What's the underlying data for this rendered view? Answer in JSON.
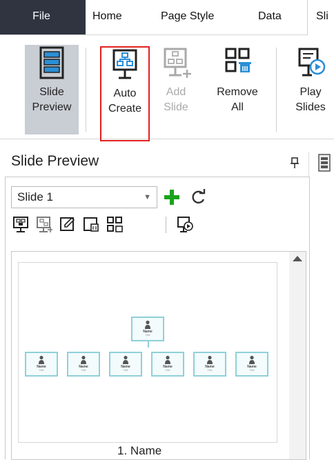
{
  "menu": {
    "items": [
      "File",
      "Home",
      "Page Style",
      "Data"
    ],
    "active_tab": "Sli"
  },
  "ribbon": {
    "slide_preview": {
      "line1": "Slide",
      "line2": "Preview"
    },
    "auto_create": {
      "line1": "Auto",
      "line2": "Create"
    },
    "add_slide": {
      "line1": "Add",
      "line2": "Slide"
    },
    "remove_all": {
      "line1": "Remove",
      "line2": "All"
    },
    "play_slides": {
      "line1": "Play",
      "line2": "Slides"
    }
  },
  "panel": {
    "title": "Slide Preview",
    "selected_slide": "Slide 1",
    "icons": [
      "pin-icon",
      "add-icon",
      "refresh-icon",
      "new-slide-icon",
      "insert-slide-icon",
      "edit-slide-icon",
      "delete-slide-icon",
      "remove-all-slides-icon",
      "play-slides-icon"
    ]
  },
  "thumbnail": {
    "caption": "1. Name",
    "root_card": {
      "name": "Name",
      "title": "Title"
    },
    "child_cards": [
      {
        "name": "Name",
        "title": "Title"
      },
      {
        "name": "Name",
        "title": "Title"
      },
      {
        "name": "Name",
        "title": "Title"
      },
      {
        "name": "Name",
        "title": "Title"
      },
      {
        "name": "Name",
        "title": "Title"
      },
      {
        "name": "Name",
        "title": "Title"
      }
    ]
  },
  "colors": {
    "file_tab_bg": "#2f3440",
    "selected_button_bg": "#c9cdd4",
    "highlight_outline": "#e02020",
    "add_icon": "#1aa31a",
    "card_border": "#8fd0d8"
  }
}
